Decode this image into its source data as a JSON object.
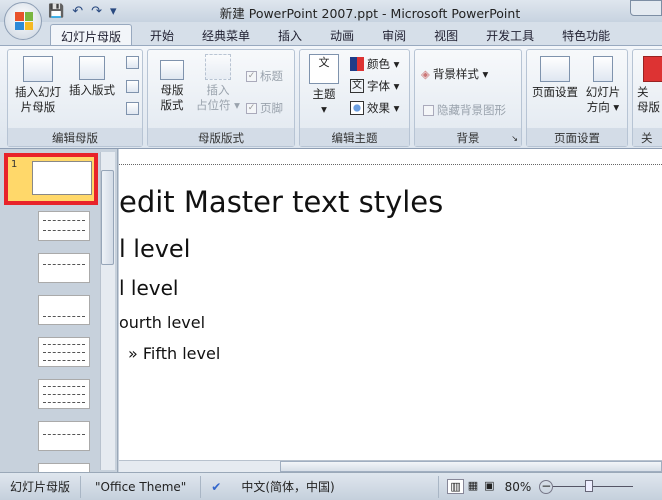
{
  "window": {
    "title": "新建 PowerPoint 2007.ppt - Microsoft PowerPoint"
  },
  "qat": {
    "save": "💾",
    "undo": "↶",
    "redo": "↷",
    "customize": "▾"
  },
  "tabs": [
    "幻灯片母版",
    "开始",
    "经典菜单",
    "插入",
    "动画",
    "审阅",
    "视图",
    "开发工具",
    "特色功能"
  ],
  "ribbon": {
    "groups": {
      "edit_master": {
        "label": "编辑母版",
        "insert_slide_master": "插入幻灯\n片母版",
        "insert_layout": "插入版式"
      },
      "master_layout": {
        "label": "母版版式",
        "master_layout": "母版\n版式",
        "insert_placeholder": "插入\n占位符 ▾",
        "title": "标题",
        "footer": "页脚"
      },
      "edit_theme": {
        "label": "编辑主题",
        "themes": "主题",
        "colors": "颜色 ▾",
        "fonts": "字体 ▾",
        "effects": "效果 ▾"
      },
      "background": {
        "label": "背景",
        "bg_styles": "背景样式 ▾",
        "hide_bg": "隐藏背景图形"
      },
      "page_setup": {
        "label": "页面设置",
        "page_setup": "页面设置",
        "orientation": "幻灯片\n方向 ▾"
      },
      "close": {
        "label": "关",
        "close": "关\n母版"
      }
    }
  },
  "thumbnails": {
    "master_number": "1"
  },
  "slide": {
    "title": "edit Master text styles",
    "levels": [
      "l level",
      "l level",
      "ourth level",
      "»  Fifth level"
    ]
  },
  "status": {
    "view": "幻灯片母版",
    "theme": "\"Office Theme\"",
    "language": "中文(简体，中国)",
    "zoom": "80%"
  }
}
